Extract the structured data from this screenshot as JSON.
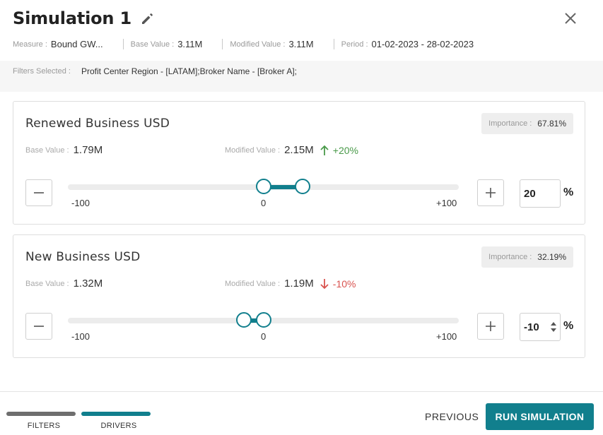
{
  "header": {
    "title": "Simulation 1",
    "measure_label": "Measure :",
    "measure_value": "Bound GW...",
    "base_label": "Base Value :",
    "base_value": "3.11M",
    "modified_label": "Modified Value :",
    "modified_value": "3.11M",
    "period_label": "Period :",
    "period_value": "01-02-2023 - 28-02-2023"
  },
  "filters": {
    "label": "Filters Selected :",
    "value": "Profit Center Region - [LATAM];Broker Name - [Broker A];"
  },
  "cards": [
    {
      "title": "Renewed Business USD",
      "importance_label": "Importance :",
      "importance_value": "67.81%",
      "base_label": "Base Value :",
      "base_value": "1.79M",
      "modified_label": "Modified Value :",
      "modified_value": "2.15M",
      "change": "+20%",
      "direction": "up",
      "change_color": "#4a9a4a",
      "slider": {
        "min": -100,
        "max": 100,
        "value": 20,
        "min_label": "-100",
        "zero_label": "0",
        "max_label": "+100"
      },
      "input_value": "20",
      "percent_sign": "%"
    },
    {
      "title": "New Business USD",
      "importance_label": "Importance :",
      "importance_value": "32.19%",
      "base_label": "Base Value :",
      "base_value": "1.32M",
      "modified_label": "Modified Value :",
      "modified_value": "1.19M",
      "change": "-10%",
      "direction": "down",
      "change_color": "#d9534f",
      "slider": {
        "min": -100,
        "max": 100,
        "value": -10,
        "min_label": "-100",
        "zero_label": "0",
        "max_label": "+100"
      },
      "input_value": "-10",
      "percent_sign": "%"
    }
  ],
  "footer": {
    "tab_filters": "FILTERS",
    "tab_drivers": "DRIVERS",
    "previous": "PREVIOUS",
    "run": "RUN SIMULATION"
  },
  "colors": {
    "accent": "#117f8d",
    "tab_inactive": "#6e6e6e"
  }
}
